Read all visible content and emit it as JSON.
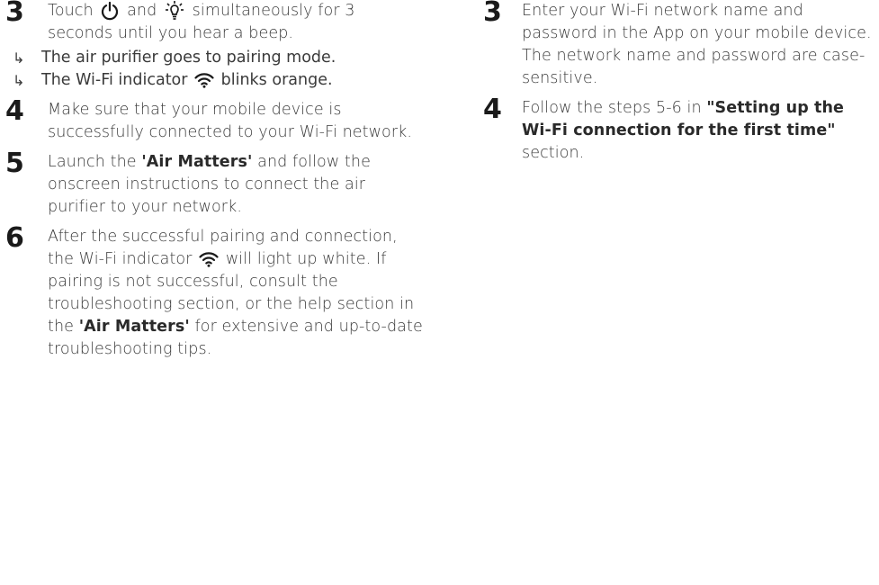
{
  "left_column": {
    "step3": {
      "number": "3",
      "text_before_power": "Touch",
      "text_and": "and",
      "text_after_light": "simultaneously for 3 seconds until you hear a beep.",
      "results": [
        {
          "arrow": "↳",
          "text": "The air purifier goes to pairing mode."
        },
        {
          "arrow": "↳",
          "text_before_icon": "The Wi-Fi indicator",
          "text_after_icon": "blinks orange."
        }
      ]
    },
    "step4": {
      "number": "4",
      "text": "Make sure that your mobile device is successfully connected to your Wi-Fi network."
    },
    "step5": {
      "number": "5",
      "text_before": "Launch the",
      "app_name": "'Air Matters'",
      "text_after": "and follow the onscreen instructions to connect the air purifier to your network."
    },
    "step6": {
      "number": "6",
      "text_before_icon": "After the successful pairing and connection, the Wi-Fi indicator",
      "text_after_icon": "will light up white. If pairing is not successful, consult the troubleshooting section, or the help section in the",
      "app_name": "'Air Matters'",
      "text_end": "for extensive and up-to-date troubleshooting tips."
    }
  },
  "right_column": {
    "step3": {
      "number": "3",
      "text": "Enter your Wi-Fi network name and password in the App on your mobile device. The network name and password are case-sensitive."
    },
    "step4": {
      "number": "4",
      "text_before": "Follow the steps 5-6 in",
      "section_ref": "\"Setting up the Wi-Fi connection for the first time\"",
      "text_after": "section."
    }
  },
  "icons": {
    "power": "power-icon",
    "light": "light-bulb-icon",
    "wifi": "wifi-icon"
  },
  "colors": {
    "text": "#3a3a3a",
    "numbers": "#1a1a1a"
  }
}
